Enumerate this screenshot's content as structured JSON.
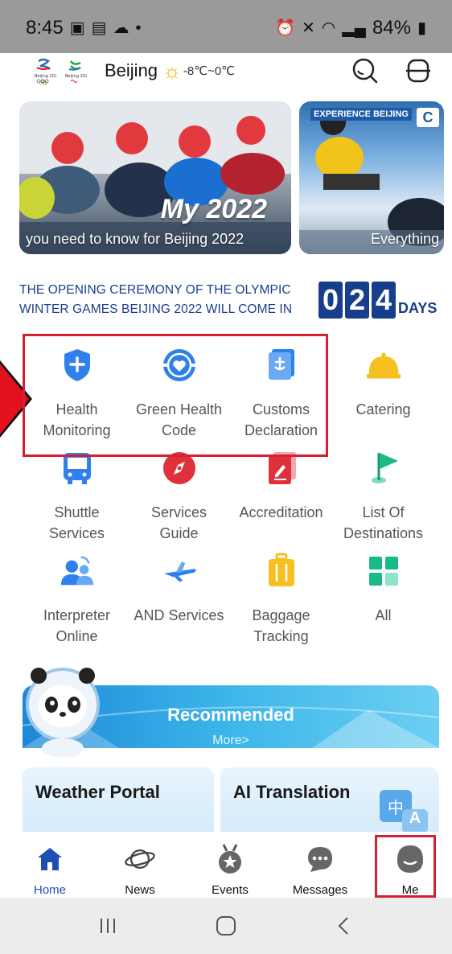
{
  "status_bar": {
    "time": "8:45",
    "battery": "84%"
  },
  "header": {
    "city": "Beijing",
    "temperature": "-8℃~0℃"
  },
  "banners": [
    {
      "caption": "you need to know for Beijing 2022",
      "overlay_text": "My 2022"
    },
    {
      "caption": "Everything",
      "overlay_text": "EXPERIENCE BEIJING"
    }
  ],
  "countdown": {
    "text_line1": "THE OPENING CEREMONY OF THE OLYMPIC",
    "text_line2": "WINTER GAMES BEIJING 2022 WILL COME IN",
    "digits": [
      "0",
      "2",
      "4"
    ],
    "unit": "DAYS"
  },
  "services": [
    {
      "label_line1": "Health",
      "label_line2": "Monitoring",
      "icon": "shield-plus-icon"
    },
    {
      "label_line1": "Green Health",
      "label_line2": "Code",
      "icon": "heart-circle-icon"
    },
    {
      "label_line1": "Customs",
      "label_line2": "Declaration",
      "icon": "customs-anchor-icon"
    },
    {
      "label_line1": "Catering",
      "label_line2": "",
      "icon": "cloche-icon"
    },
    {
      "label_line1": "Shuttle",
      "label_line2": "Services",
      "icon": "bus-icon"
    },
    {
      "label_line1": "Services",
      "label_line2": "Guide",
      "icon": "compass-icon"
    },
    {
      "label_line1": "Accreditation",
      "label_line2": "",
      "icon": "accreditation-pen-icon"
    },
    {
      "label_line1": "List Of",
      "label_line2": "Destinations",
      "icon": "flag-icon"
    },
    {
      "label_line1": "Interpreter",
      "label_line2": "Online",
      "icon": "interpreter-people-icon"
    },
    {
      "label_line1": "AND Services",
      "label_line2": "",
      "icon": "airplane-icon"
    },
    {
      "label_line1": "Baggage",
      "label_line2": "Tracking",
      "icon": "luggage-icon"
    },
    {
      "label_line1": "All",
      "label_line2": "",
      "icon": "grid-icon"
    }
  ],
  "recommended": {
    "title": "Recommended",
    "more": "More>",
    "cards": [
      {
        "title": "Weather Portal"
      },
      {
        "title": "AI Translation",
        "badge_zh": "中",
        "badge_a": "A"
      }
    ]
  },
  "bottom_nav": {
    "items": [
      {
        "label": "Home",
        "icon": "home-icon",
        "active": true
      },
      {
        "label": "News",
        "icon": "planet-icon",
        "active": false
      },
      {
        "label": "Events",
        "icon": "medal-icon",
        "active": false
      },
      {
        "label": "Messages",
        "icon": "chat-bubble-icon",
        "active": false
      },
      {
        "label": "Me",
        "icon": "user-avatar-icon",
        "active": false
      }
    ]
  },
  "colors": {
    "primary_blue": "#1f4fb5",
    "countdown_blue": "#173d8d",
    "highlight_red": "#d42132",
    "service_blue": "#2f80ed",
    "catering_yellow": "#f6c021",
    "service_red": "#e0303b",
    "flag_green": "#19b98a"
  }
}
